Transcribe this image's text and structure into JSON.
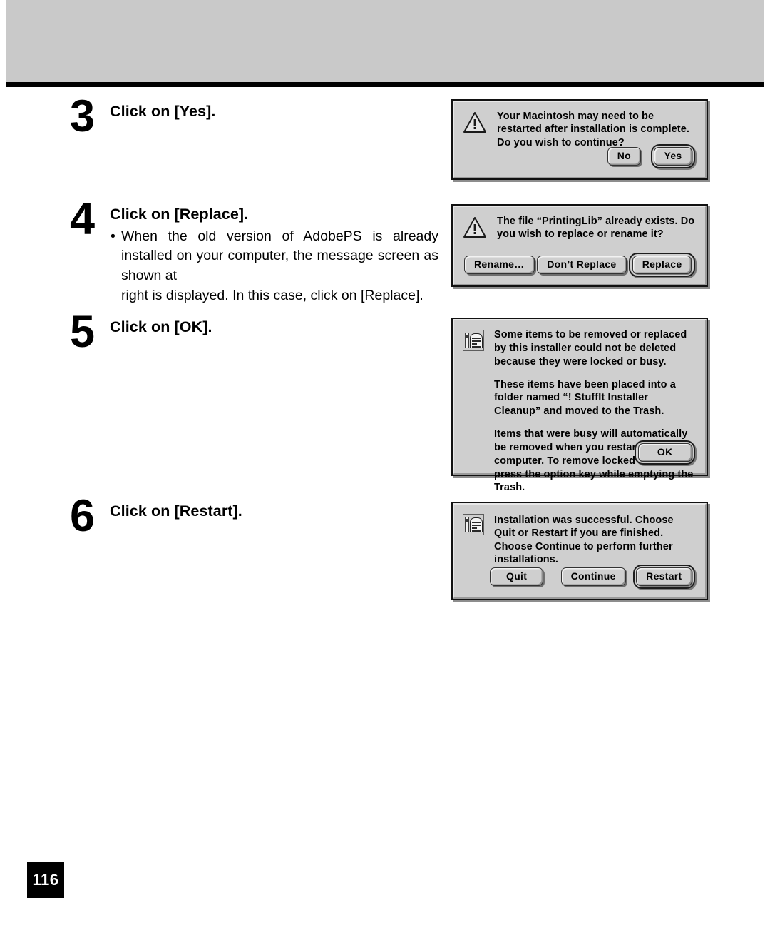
{
  "page": {
    "number": "116"
  },
  "steps": [
    {
      "number": "3",
      "title": "Click on [Yes].",
      "bullets": []
    },
    {
      "number": "4",
      "title": "Click on [Replace].",
      "bullets": [
        {
          "line1": "When the old version of AdobePS is already installed",
          "line2": "on your computer, the message screen as shown at",
          "line3": "right is displayed.  In this case, click on [Replace]."
        }
      ]
    },
    {
      "number": "5",
      "title": "Click on [OK].",
      "bullets": []
    },
    {
      "number": "6",
      "title": "Click on [Restart].",
      "bullets": []
    }
  ],
  "dialogs": {
    "restart_prompt": {
      "icon": "warning-triangle-icon",
      "paragraphs": [
        "Your Macintosh may need to be restarted after installation is complete.  Do you wish to continue?"
      ],
      "buttons": [
        {
          "label": "No",
          "default": false
        },
        {
          "label": "Yes",
          "default": true
        }
      ]
    },
    "replace": {
      "icon": "warning-triangle-icon",
      "paragraphs": [
        "The file “PrintingLib” already exists.  Do you wish to replace or rename it?"
      ],
      "buttons": [
        {
          "label": "Rename…",
          "default": false
        },
        {
          "label": "Don’t Replace",
          "default": false
        },
        {
          "label": "Replace",
          "default": true
        }
      ]
    },
    "cleanup": {
      "icon": "installer-document-icon",
      "paragraphs": [
        "Some items to be removed or replaced by this installer could not be deleted because they were locked or busy.",
        "These items have been placed into a folder named “! StuffIt Installer Cleanup” and moved to the Trash.",
        "Items that were busy will automatically be removed when you restart your computer. To remove locked items, press the option key while emptying the Trash."
      ],
      "buttons": [
        {
          "label": "OK",
          "default": true
        }
      ]
    },
    "success": {
      "icon": "installer-document-icon",
      "paragraphs": [
        "Installation was successful.  Choose Quit or Restart if you are finished. Choose Continue to perform further installations."
      ],
      "buttons": [
        {
          "label": "Quit",
          "default": false
        },
        {
          "label": "Continue",
          "default": false
        },
        {
          "label": "Restart",
          "default": true
        }
      ]
    }
  },
  "colors": {
    "header_band": "#c9c9c9",
    "header_rule": "#000000",
    "dialog_face": "#cfcfcf",
    "page_badge": "#000000"
  }
}
